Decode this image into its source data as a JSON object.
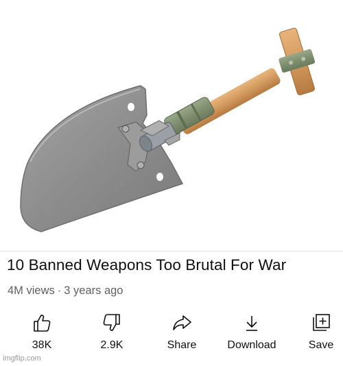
{
  "video": {
    "title": "10 Banned Weapons Too Brutal For War",
    "views": "4M views",
    "separator": "·",
    "age": "3 years ago"
  },
  "actions": [
    {
      "label": "38K",
      "icon": "thumbs-up-icon"
    },
    {
      "label": "2.9K",
      "icon": "thumbs-down-icon"
    },
    {
      "label": "Share",
      "icon": "share-arrow-icon"
    },
    {
      "label": "Download",
      "icon": "download-icon"
    },
    {
      "label": "Save",
      "icon": "save-to-playlist-icon"
    }
  ],
  "watermark": "imgflip.com",
  "colors": {
    "title_text": "#0f0f0f",
    "meta_text": "#606060",
    "shovel_blade": "#8e8e8e",
    "shovel_handle": "#d39a5e",
    "shovel_grip": "#7f8f6f"
  }
}
